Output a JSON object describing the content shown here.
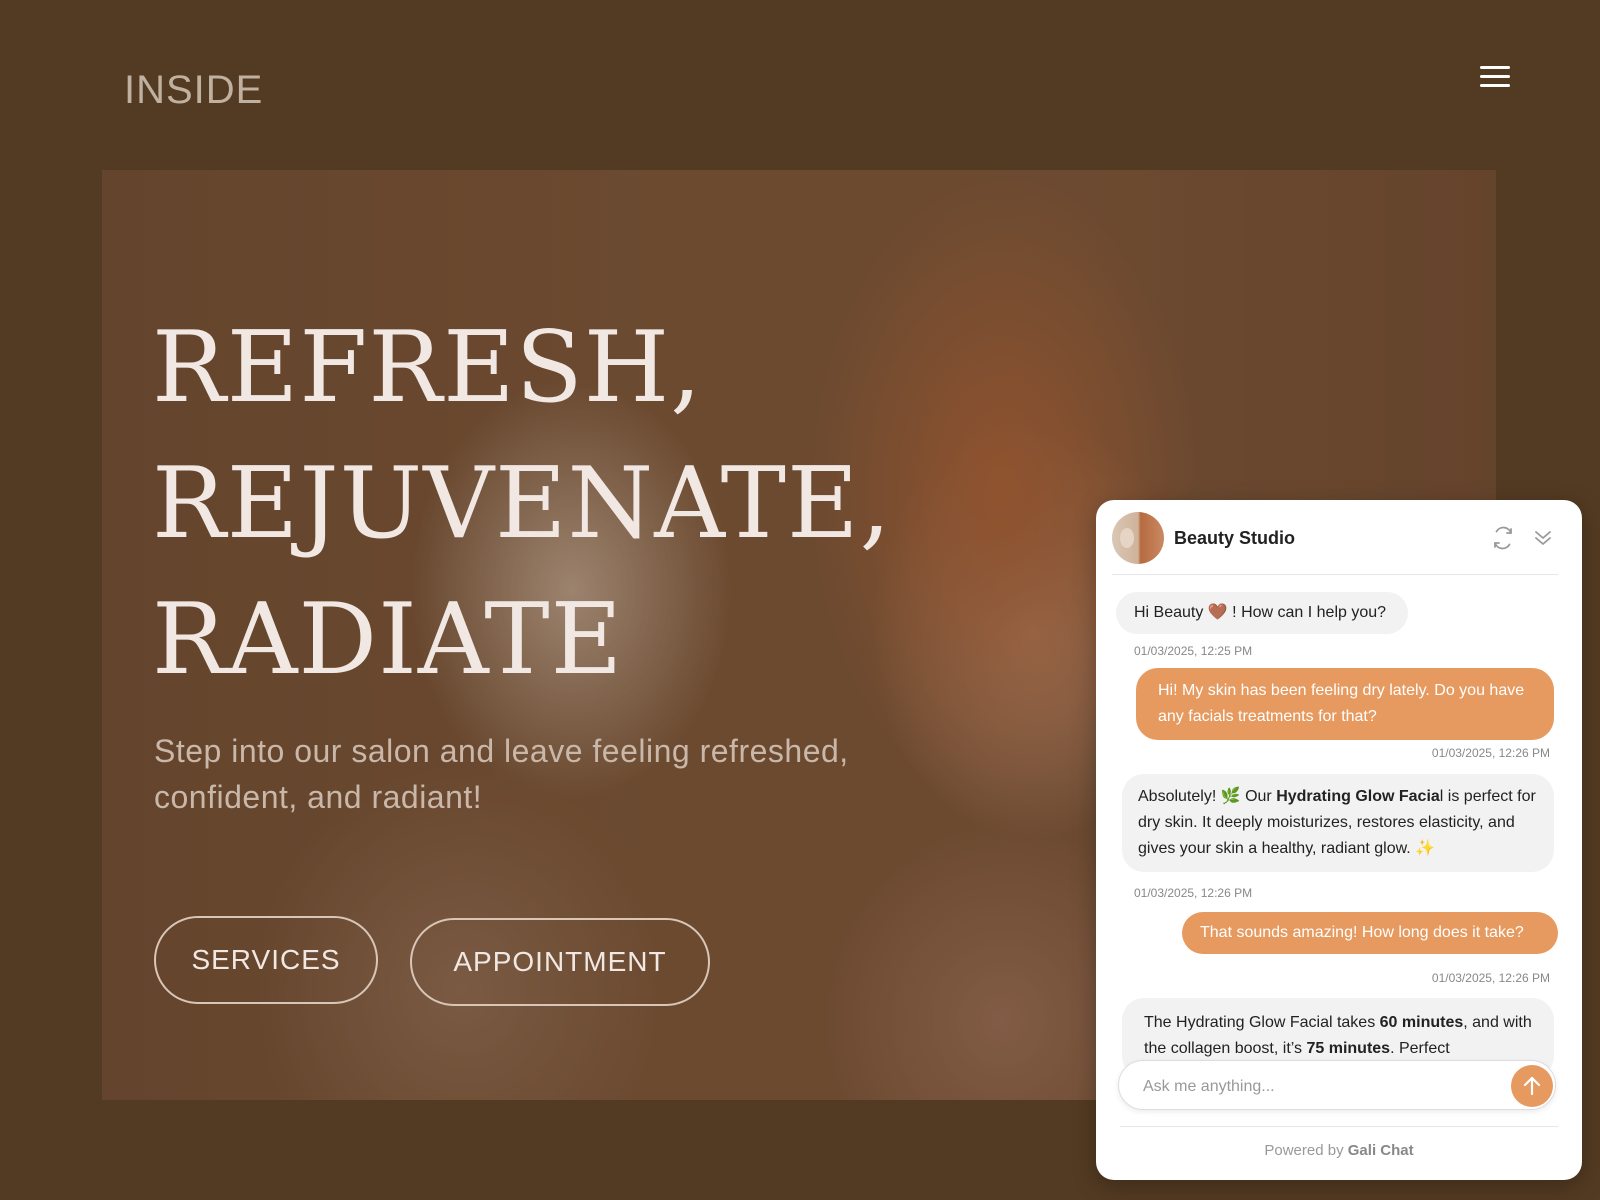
{
  "brand": {
    "logo": "INSIDE"
  },
  "header": {
    "menu_icon": "hamburger-menu-icon"
  },
  "hero": {
    "headline": [
      "REFRESH,",
      "REJUVENATE,",
      "RADIATE"
    ],
    "subtitle": "Step into our salon and leave feeling refreshed, confident, and radiant!",
    "buttons": {
      "services": "SERVICES",
      "appointment": "APPOINTMENT"
    }
  },
  "chat": {
    "title": "Beauty Studio",
    "icons": {
      "refresh": "refresh-icon",
      "collapse": "double-chevron-down-icon",
      "send": "arrow-up-icon"
    },
    "messages": [
      {
        "from": "bot",
        "text": "Hi Beauty 🤎 ! How can I help you?",
        "time": "01/03/2025, 12:25 PM"
      },
      {
        "from": "user",
        "text": "Hi! My skin has been feeling dry lately. Do you have any facials treatments for that?",
        "time": "01/03/2025, 12:26 PM"
      },
      {
        "from": "bot",
        "pre": "Absolutely! 🌿 Our ",
        "bold1": "Hydrating Glow Facia",
        "post": "l is perfect for dry skin. It deeply moisturizes, restores elasticity, and gives your skin a healthy, radiant glow. ✨",
        "time": "01/03/2025, 12:26 PM"
      },
      {
        "from": "user",
        "text": "That sounds amazing! How long does it take?",
        "time": "01/03/2025, 12:26 PM"
      },
      {
        "from": "bot",
        "pre": "The Hydrating Glow Facial takes ",
        "bold1": "60 minutes",
        "mid": ", and with the collagen boost, it’s ",
        "bold2": "75 minutes",
        "post": ". Perfect"
      }
    ],
    "input_placeholder": "Ask me anything...",
    "input_value": "",
    "footer_prefix": "Powered by",
    "footer_brand": "Gali Chat"
  },
  "colors": {
    "background": "#533a22",
    "accent": "#e69a60"
  }
}
